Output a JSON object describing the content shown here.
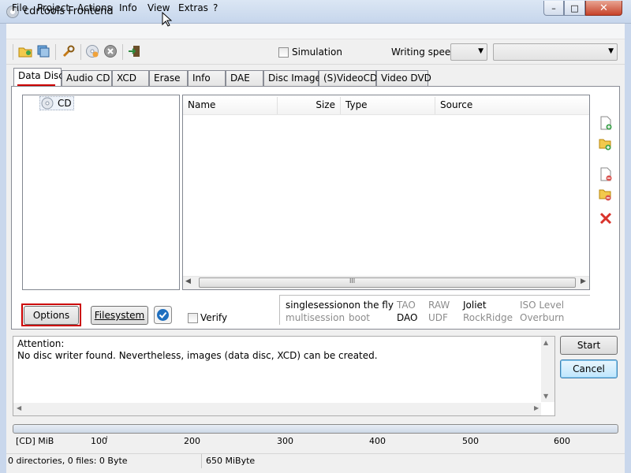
{
  "window": {
    "title": "cdrtools Frontend",
    "minimize": "–",
    "maximize": "□",
    "close": "✕"
  },
  "menu": [
    {
      "label": "File"
    },
    {
      "label": "Project"
    },
    {
      "label": "Actions"
    },
    {
      "label": "Info"
    },
    {
      "label": "View"
    },
    {
      "label": "Extras"
    },
    {
      "label": "?"
    }
  ],
  "toolbar": {
    "simulation_label": "Simulation",
    "simulation_checked": false,
    "writing_speed_label": "Writing speed",
    "writing_speed_value": "",
    "device_value": ""
  },
  "tabs": [
    {
      "label": "Data Disc",
      "active": true
    },
    {
      "label": "Audio CD"
    },
    {
      "label": "XCD"
    },
    {
      "label": "Erase"
    },
    {
      "label": "Info"
    },
    {
      "label": "DAE"
    },
    {
      "label": "Disc Image"
    },
    {
      "label": "(S)VideoCD"
    },
    {
      "label": "Video DVD"
    }
  ],
  "tree": {
    "root_label": "CD"
  },
  "file_list": {
    "columns": [
      "Name",
      "Size",
      "Type",
      "Source"
    ],
    "rows": [],
    "scroll_grip": "III"
  },
  "buttons": {
    "options": "Options",
    "filesystem": "Filesystem",
    "verify_label": "Verify",
    "verify_checked": false,
    "start": "Start",
    "cancel": "Cancel"
  },
  "options": {
    "row1": [
      {
        "label": "singlesession",
        "enabled": true
      },
      {
        "label": "on the fly",
        "enabled": true
      },
      {
        "label": "TAO",
        "enabled": false
      },
      {
        "label": "RAW",
        "enabled": false
      },
      {
        "label": "Joliet",
        "enabled": true
      },
      {
        "label": "ISO Level",
        "enabled": false
      }
    ],
    "row2": [
      {
        "label": "multisession",
        "enabled": false
      },
      {
        "label": "boot",
        "enabled": false
      },
      {
        "label": "DAO",
        "enabled": true
      },
      {
        "label": "UDF",
        "enabled": false
      },
      {
        "label": "RockRidge",
        "enabled": false
      },
      {
        "label": "Overburn",
        "enabled": false
      }
    ]
  },
  "messages": {
    "line1": "Attention:",
    "line2": "No disc writer found. Nevertheless, images (data disc, XCD) can be created."
  },
  "progress": {
    "fraction": 0,
    "unit_label": "[CD] MiB",
    "ticks": [
      "100",
      "200",
      "300",
      "400",
      "500",
      "600"
    ]
  },
  "status": {
    "files": "0 directories, 0 files: 0 Byte",
    "capacity": "650 MiByte"
  },
  "colors": {
    "accent": "#cc0000",
    "verify_blue": "#1f6fbf"
  }
}
